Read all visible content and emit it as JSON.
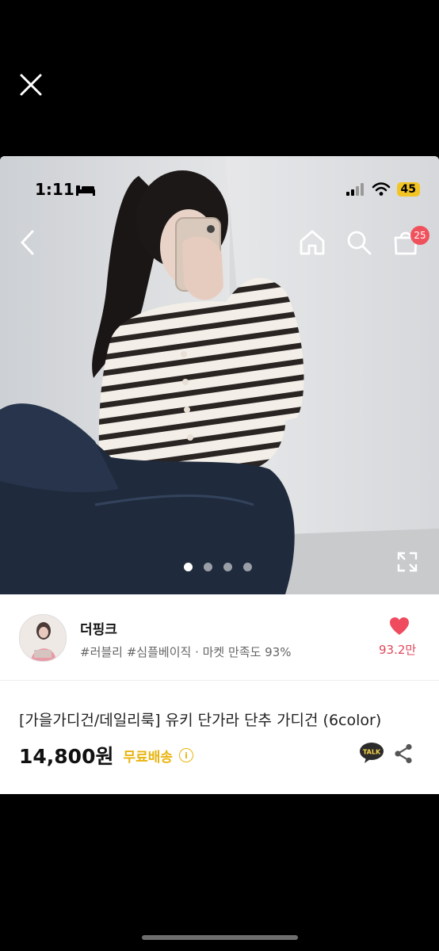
{
  "status_bar": {
    "time": "1:11",
    "battery": "45"
  },
  "nav": {
    "cart_badge": "25"
  },
  "carousel": {
    "total": 4,
    "active": 0
  },
  "seller": {
    "name": "더핑크",
    "tags": "#러블리 #심플베이직 · 마켓 만족도 93%",
    "likes": "93.2만"
  },
  "product": {
    "title": "[가을가디건/데일리룩] 유키 단가라 단추 가디건 (6color)",
    "price": "14,800원",
    "shipping": "무료배송",
    "info_symbol": "i",
    "talk_label": "TALK"
  },
  "colors": {
    "accent_red": "#e0485a",
    "badge": "#f0525d",
    "shipping": "#e9b40f",
    "talk": "#2b2b2b"
  }
}
